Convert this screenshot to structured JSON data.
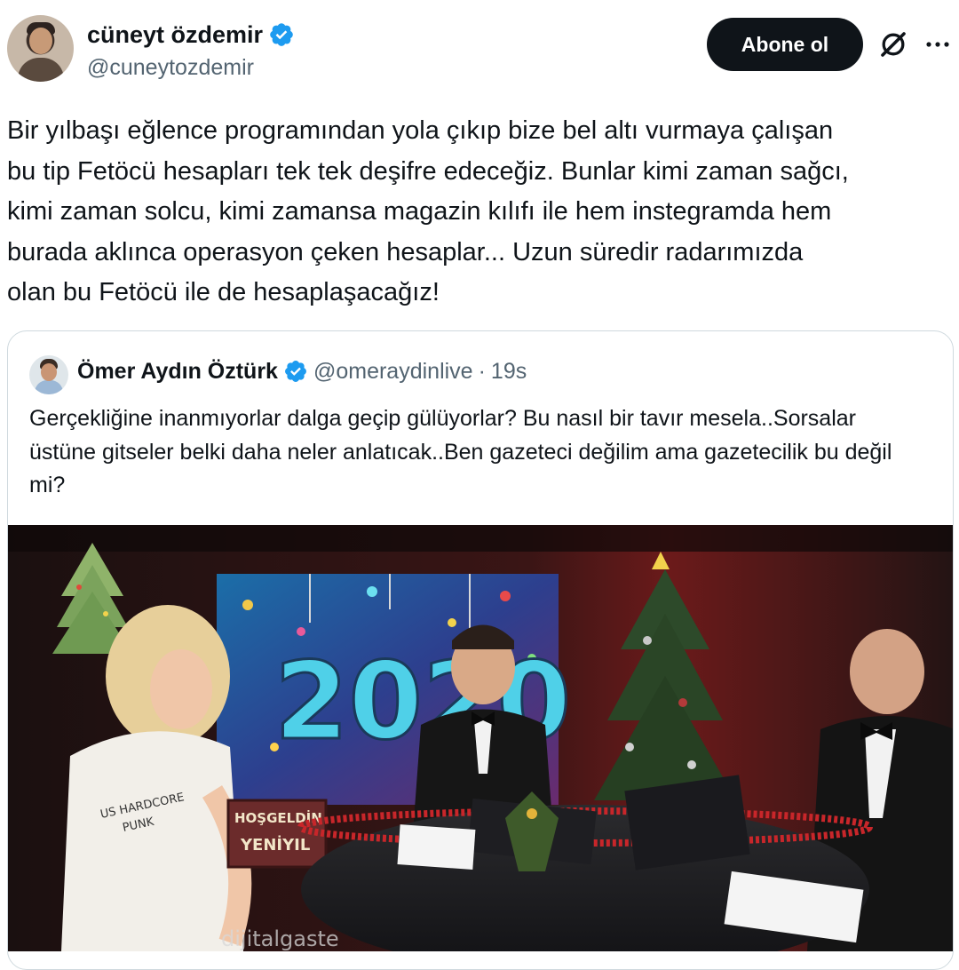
{
  "author": {
    "display_name": "cüneyt özdemir",
    "handle": "@cuneytozdemir"
  },
  "actions": {
    "follow_label": "Abone ol"
  },
  "tweet": {
    "text": "Bir yılbaşı eğlence programından yola çıkıp bize bel altı vurmaya çalışan\nbu tip Fetöcü hesapları tek tek deşifre edeceğiz. Bunlar kimi zaman sağcı,\nkimi zaman solcu, kimi zamansa magazin kılıfı ile hem instegramda hem\nburada aklınca operasyon çeken hesaplar... Uzun süredir radarımızda\nolan bu Fetöcü ile de hesaplaşacağız!"
  },
  "quote": {
    "display_name": "Ömer Aydın Öztürk",
    "handle": "@omeraydinlive",
    "separator": "·",
    "time": "19s",
    "text": "Gerçekliğine inanmıyorlar dalga geçip gülüyorlar? Bu nasıl bir tavır mesela..Sorsalar üstüne gitseler belki daha neler anlatıcak..Ben gazeteci değilim ama gazetecilik bu değil mi?"
  },
  "media": {
    "backdrop_year": "2020",
    "sign_line1": "HOŞGELDİN",
    "sign_line2": "YENİYIL",
    "shirt_text_1": "US HARDCORE",
    "shirt_text_2": "PUNK",
    "watermark": "dijitalgaste"
  },
  "colors": {
    "verified": "#1d9bf0",
    "follow_bg": "#0f1419",
    "secondary_text": "#536471",
    "border": "#cfd9de"
  }
}
